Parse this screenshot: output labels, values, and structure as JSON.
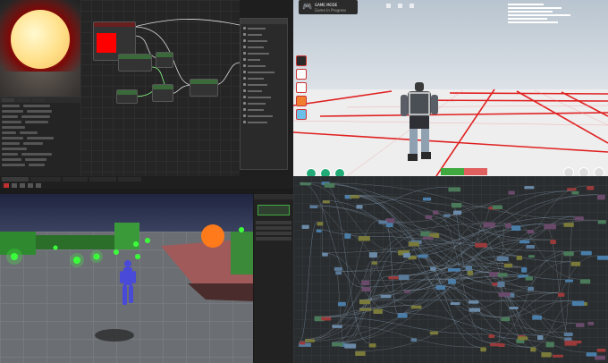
{
  "material_editor": {
    "palette_items": [
      "",
      "",
      "",
      "",
      "",
      "",
      "",
      ""
    ],
    "colors": {
      "preview_glow": "#ff2a1a",
      "sun": "#ffe089",
      "node_red": "#ff0000"
    }
  },
  "game": {
    "hud_title": "GAME MODE",
    "hud_subtitle": "Game In Progress",
    "colors": {
      "grid_line": "#e02020",
      "hud_green": "#4caf50"
    }
  },
  "level_editor": {
    "viewport_label": "",
    "colors": {
      "ball_orange": "#ff7a1a",
      "glow_green": "#3cff3c",
      "character": "#4a4ad8"
    }
  },
  "blueprint": {
    "colors": {
      "node_blue": "#4a7ea8",
      "node_red": "#9a3a3a",
      "wire": "#7fa8c8"
    }
  }
}
